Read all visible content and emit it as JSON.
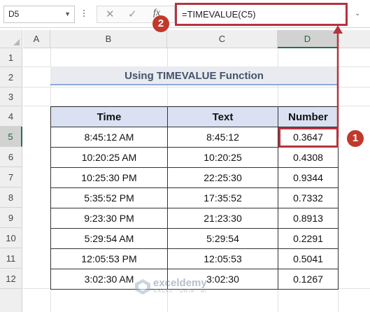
{
  "formula_bar": {
    "name_box": "D5",
    "formula": "=TIMEVALUE(C5)",
    "cancel_glyph": "✕",
    "enter_glyph": "✓",
    "fx_glyph": "fx"
  },
  "columns": [
    "A",
    "B",
    "C",
    "D"
  ],
  "rows": [
    "1",
    "2",
    "3",
    "4",
    "5",
    "6",
    "7",
    "8",
    "9",
    "10",
    "11",
    "12"
  ],
  "sheet": {
    "title": "Using TIMEVALUE Function",
    "headers": [
      "Time",
      "Text",
      "Number"
    ],
    "table": [
      [
        "8:45:12 AM",
        "8:45:12",
        "0.3647"
      ],
      [
        "10:20:25 AM",
        "10:20:25",
        "0.4308"
      ],
      [
        "10:25:30 PM",
        "22:25:30",
        "0.9344"
      ],
      [
        "5:35:52 PM",
        "17:35:52",
        "0.7332"
      ],
      [
        "9:23:30 PM",
        "21:23:30",
        "0.8913"
      ],
      [
        "5:29:54 AM",
        "5:29:54",
        "0.2291"
      ],
      [
        "12:05:53 PM",
        "12:05:53",
        "0.5041"
      ],
      [
        "3:02:30 AM",
        "3:02:30",
        "0.1267"
      ]
    ]
  },
  "annotations": {
    "badge_1": "1",
    "badge_2": "2",
    "color": "#b5333e"
  },
  "watermark": {
    "name": "exceldemy",
    "tagline": "EXCEL · DATA · BI"
  }
}
